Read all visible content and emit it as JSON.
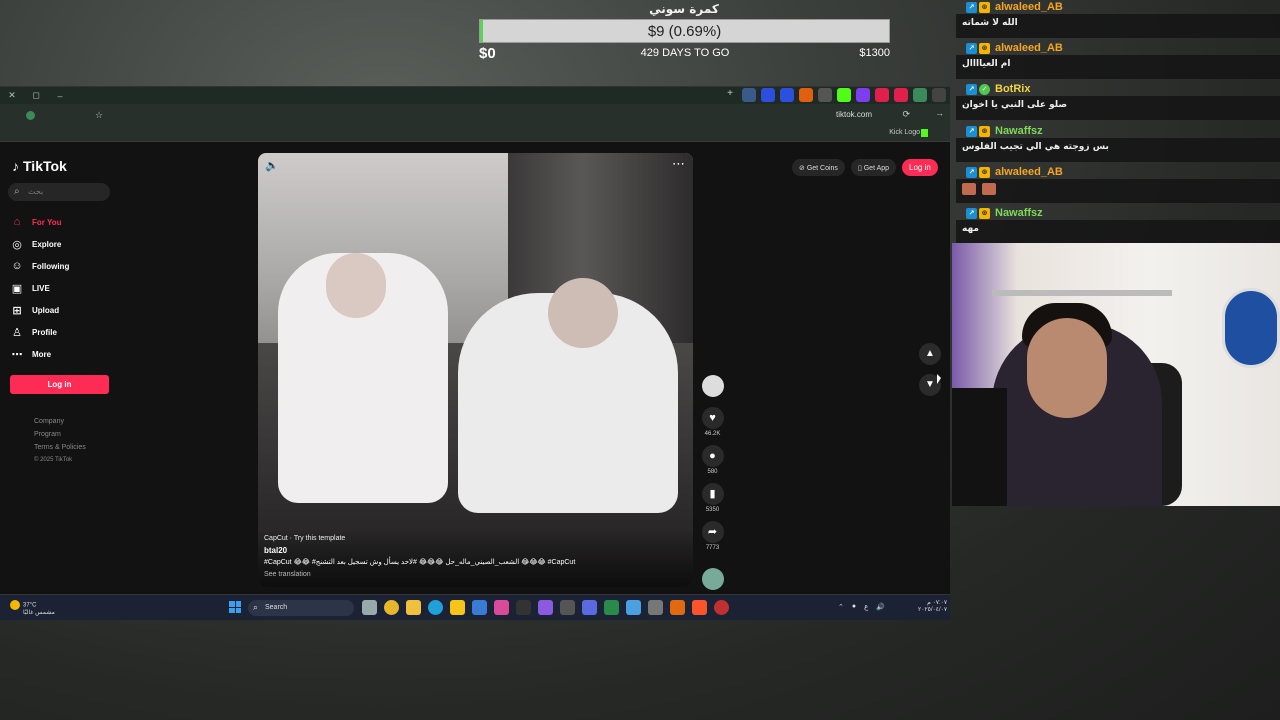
{
  "goal": {
    "title": "كمرة سوني",
    "amount": "$9 (0.69%)",
    "progress_percent": 0.69,
    "min": "$0",
    "days": "429 DAYS TO GO",
    "max": "$1300"
  },
  "browser": {
    "url": "tiktok.com",
    "bookmark": "Kick Logo"
  },
  "tiktok": {
    "logo": "TikTok",
    "search_placeholder": "بحث",
    "nav": [
      "For You",
      "Explore",
      "Following",
      "LIVE",
      "Upload",
      "Profile",
      "More"
    ],
    "login_label": "Log in",
    "footer": [
      "Company",
      "Program",
      "Terms & Policies",
      "© 2025 TikTok"
    ],
    "get_coins": "Get Coins",
    "get_app": "Get App",
    "top_login": "Log in"
  },
  "video": {
    "capcut": "CapCut · Try this template",
    "username": "btal20",
    "caption": "#CapCut 😂😂 #الشعب_الصيني_ماله_حل 😂😂😂 #لاحد يسأل وش تسجيل بعد التشنج 😂😂😂 #CapCut",
    "see_translation": "See translation",
    "likes": "46.2K",
    "comments": "580",
    "saves": "5350",
    "shares": "7773"
  },
  "taskbar": {
    "temp": "37°C",
    "weather": "مشمس غالبًا",
    "search": "Search",
    "time": "٠٧:٠٧ م",
    "date": "٢٠٢٥/٠٤/٠٧"
  },
  "chat": [
    {
      "user": "alwaleed_AB",
      "color": "#f5a623",
      "text": "الله لا شماته",
      "badges": [
        "b1",
        "b2"
      ]
    },
    {
      "user": "alwaleed_AB",
      "color": "#f5a623",
      "text": "ام العياااال",
      "badges": [
        "b1",
        "b2"
      ]
    },
    {
      "user": "BotRix",
      "color": "#f5d33c",
      "text": "صلو على النبي يا اخوان",
      "badges": [
        "b1",
        "b3"
      ]
    },
    {
      "user": "Nawaffsz",
      "color": "#7ed957",
      "text": "بس زوجته هي الي تجيب الفلوس",
      "badges": [
        "b1",
        "b2"
      ]
    },
    {
      "user": "alwaleed_AB",
      "color": "#f5a623",
      "text": "",
      "badges": [
        "b1",
        "b2"
      ]
    },
    {
      "user": "Nawaffsz",
      "color": "#7ed957",
      "text": "مهه",
      "badges": [
        "b1",
        "b2"
      ]
    }
  ]
}
